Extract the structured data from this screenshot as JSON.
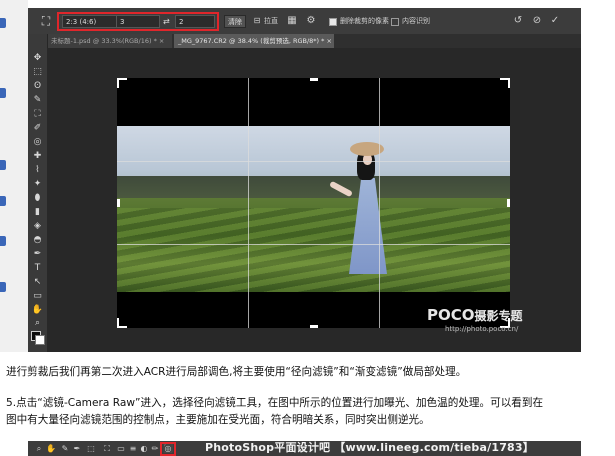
{
  "photoshop": {
    "options_bar": {
      "ratio_value": "2:3 (4:6)",
      "width_value": "3",
      "swap_glyph": "⇄",
      "height_value": "2",
      "clear_button": "清除",
      "straighten_label": "拉直",
      "overlay_glyph": "▦",
      "settings_glyph": "⚙",
      "delete_cropped_label": "删除裁剪的像素",
      "delete_cropped_checked": true,
      "content_aware_label": "内容识别",
      "content_aware_checked": false,
      "reset_glyph": "↺",
      "cancel_glyph": "⊘",
      "commit_glyph": "✓"
    },
    "tabs": [
      {
        "label": "未标题-1.psd @ 33.3%(RGB/16) * ×",
        "active": false
      },
      {
        "label": "_MG_9767.CR2 @ 38.4% (裁剪预选, RGB/8*) * ×",
        "active": true
      }
    ],
    "tools": [
      "✥",
      "⬚",
      "ʘ",
      "✎",
      "⛶",
      "✐",
      "◎",
      "✚",
      "⌇",
      "✦",
      "⬮",
      "▮",
      "◈",
      "◓",
      "✒",
      "T",
      "↖",
      "▭",
      "✋",
      "⌕",
      "⋯"
    ],
    "watermark": {
      "brand": "POCO",
      "brand_sub": "摄影专题",
      "url": "http://photo.poco.cn/"
    },
    "accent_color": "#e0262b"
  },
  "article": {
    "line1": "进行剪裁后我们再第二次进入ACR进行局部调色,将主要使用“径向滤镜”和“渐变滤镜”做局部处理。",
    "line2": "5.点击“滤镜-Camera Raw”进入，选择径向滤镜工具，在图中所示的位置进行加曝光、加色温的处理。可以看到在",
    "line3": "图中有大量径向滤镜范围的控制点，主要施加在受光面，符合明暗关系，同时突出侧逆光。"
  },
  "bottom_strip": {
    "icons": [
      "⌕",
      "✋",
      "✎",
      "✒",
      "⬚",
      "⛶",
      "▭",
      "≡",
      "◐",
      "✏",
      "⬛",
      "◎"
    ],
    "watermark": "PhotoShop平面设计吧 【www.lineeg.com/tieba/1783】"
  }
}
